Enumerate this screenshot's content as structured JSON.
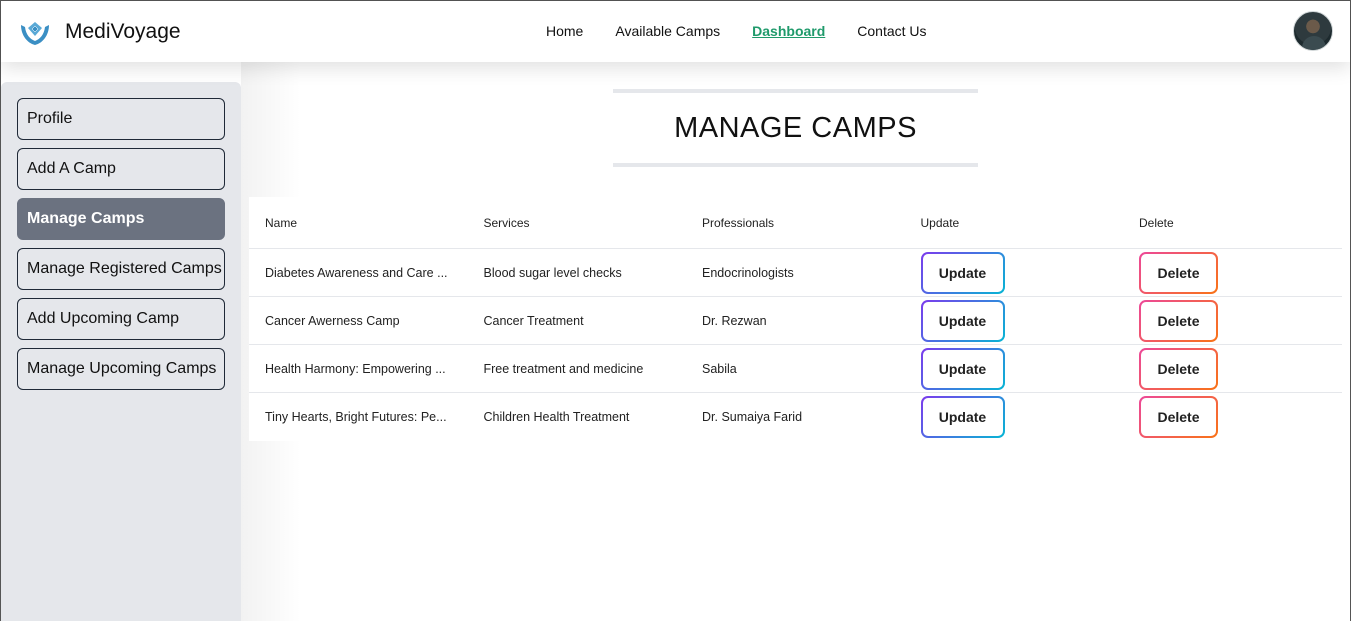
{
  "brand": {
    "name": "MediVoyage",
    "logo_icon": "hands-heart-icon"
  },
  "nav": {
    "links": [
      {
        "label": "Home",
        "active": false
      },
      {
        "label": "Available Camps",
        "active": false
      },
      {
        "label": "Dashboard",
        "active": true
      },
      {
        "label": "Contact Us",
        "active": false
      }
    ],
    "active_color": "#1f9a6b"
  },
  "sidebar": {
    "items": [
      {
        "label": "Profile",
        "active": false
      },
      {
        "label": "Add A Camp",
        "active": false
      },
      {
        "label": "Manage Camps",
        "active": true
      },
      {
        "label": "Manage Registered Camps",
        "active": false
      },
      {
        "label": "Add Upcoming Camp",
        "active": false
      },
      {
        "label": "Manage Upcoming Camps",
        "active": false
      }
    ]
  },
  "main": {
    "title": "MANAGE CAMPS",
    "table": {
      "headers": [
        "Name",
        "Services",
        "Professionals",
        "Update",
        "Delete"
      ],
      "rows": [
        {
          "name": "Diabetes Awareness and Care ...",
          "services": "Blood sugar level checks",
          "professionals": "Endocrinologists",
          "update": "Update",
          "delete": "Delete"
        },
        {
          "name": "Cancer Awerness Camp",
          "services": "Cancer Treatment",
          "professionals": "Dr. Rezwan",
          "update": "Update",
          "delete": "Delete"
        },
        {
          "name": "Health Harmony: Empowering ...",
          "services": "Free treatment and medicine",
          "professionals": "Sabila",
          "update": "Update",
          "delete": "Delete"
        },
        {
          "name": "Tiny Hearts, Bright Futures: Pe...",
          "services": "Children Health Treatment",
          "professionals": "Dr. Sumaiya Farid",
          "update": "Update",
          "delete": "Delete"
        }
      ]
    }
  }
}
